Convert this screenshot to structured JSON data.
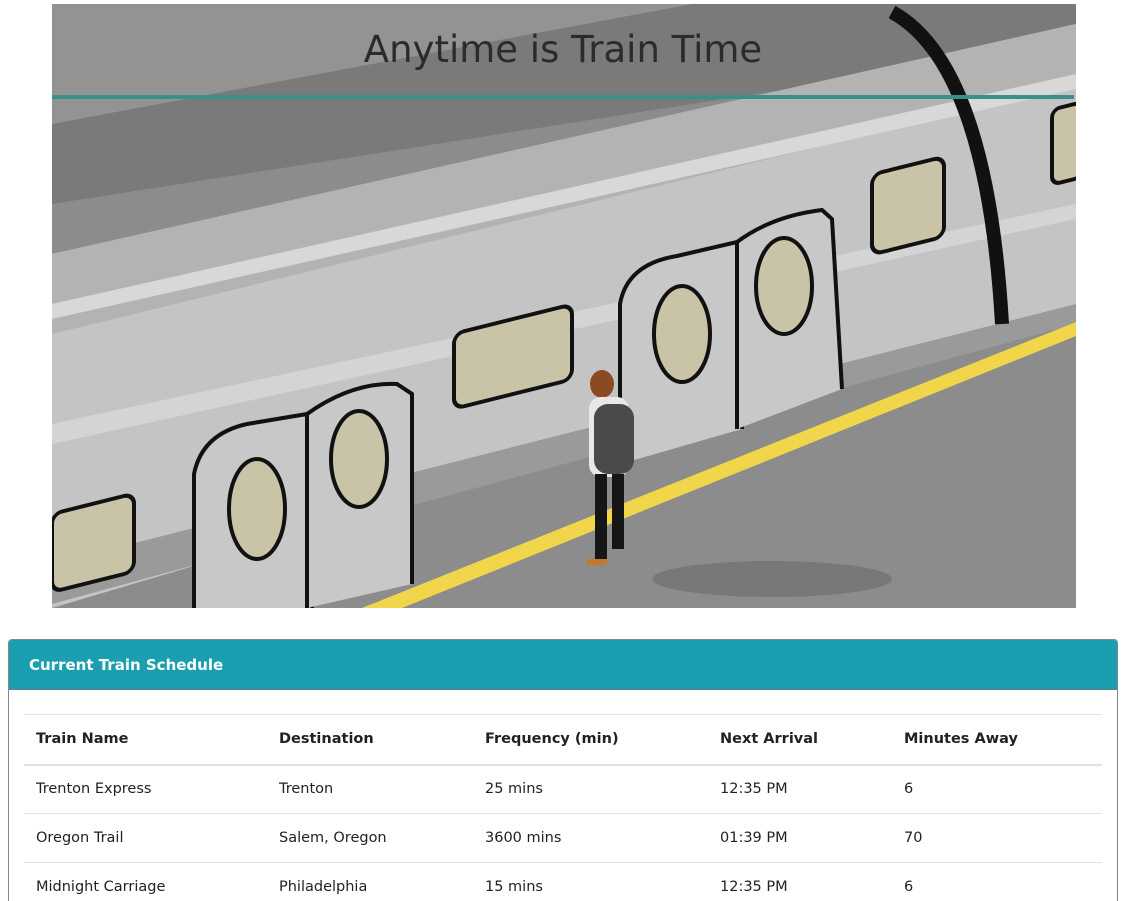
{
  "hero": {
    "title": "Anytime is Train Time",
    "image_name": "train-platform-illustration",
    "colors": {
      "accent_rule": "#3a8f8a",
      "platform_line": "#f1d54a",
      "train_body": "#c9c9c9"
    }
  },
  "schedule": {
    "header_title": "Current Train Schedule",
    "header_color": "#1a9eb0",
    "columns": [
      "Train Name",
      "Destination",
      "Frequency (min)",
      "Next Arrival",
      "Minutes Away"
    ],
    "rows": [
      [
        "Trenton Express",
        "Trenton",
        "25 mins",
        "12:35 PM",
        "6"
      ],
      [
        "Oregon Trail",
        "Salem, Oregon",
        "3600 mins",
        "01:39 PM",
        "70"
      ],
      [
        "Midnight Carriage",
        "Philadelphia",
        "15 mins",
        "12:35 PM",
        "6"
      ]
    ]
  }
}
